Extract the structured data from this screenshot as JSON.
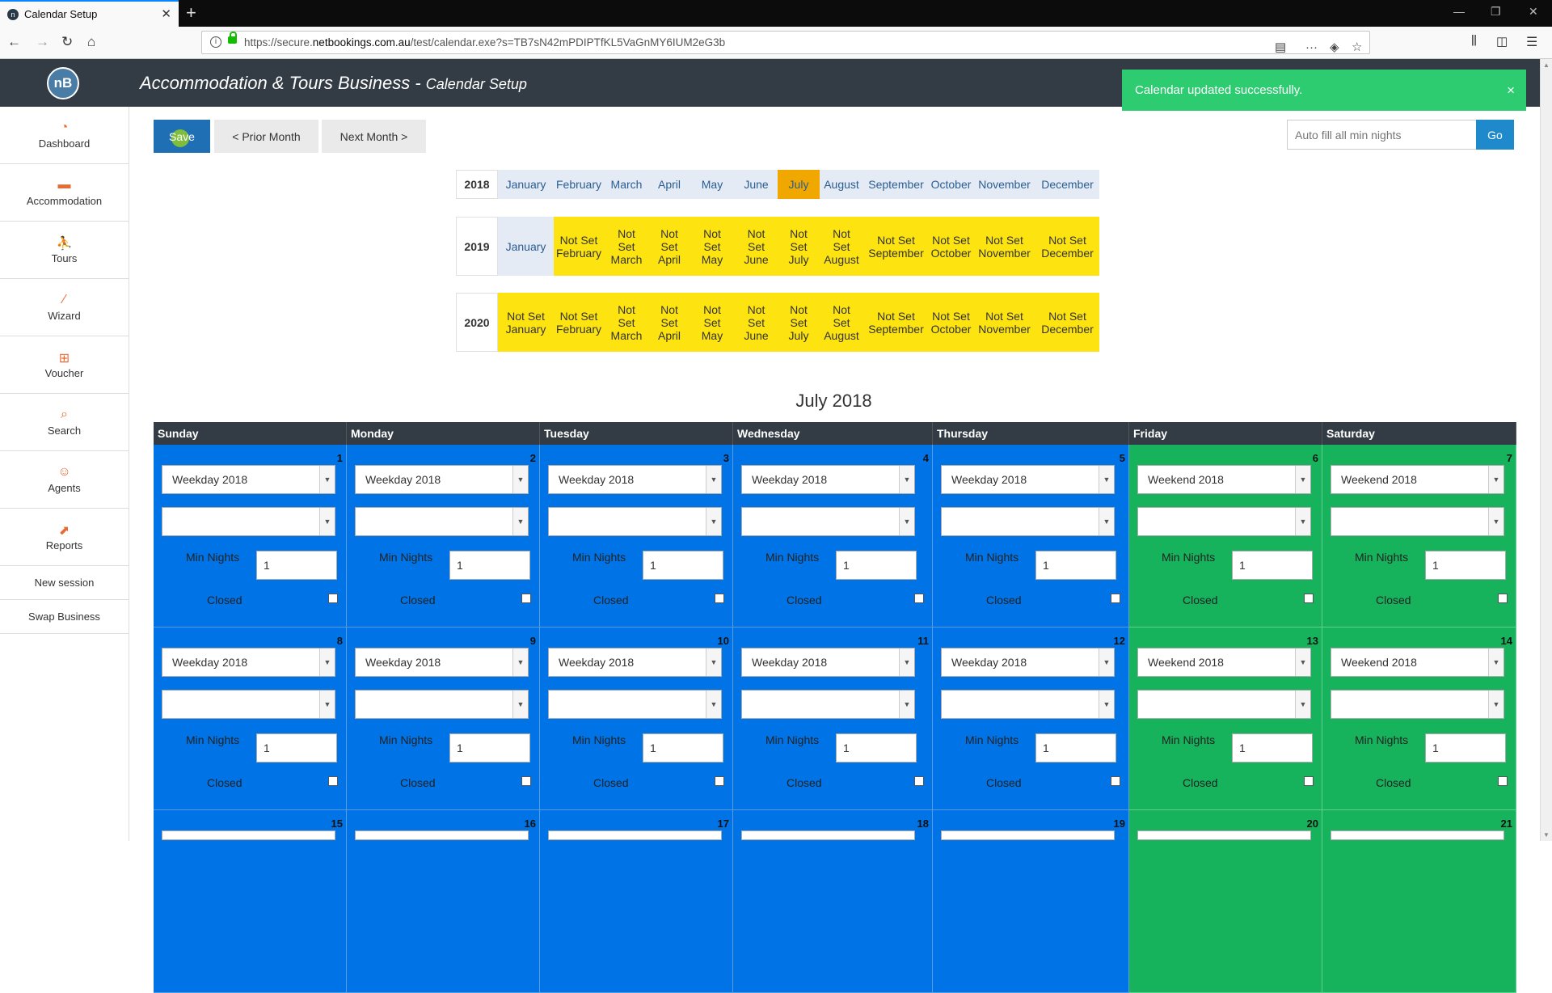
{
  "browser": {
    "tab_title": "Calendar Setup",
    "url_prefix": "https://secure.",
    "url_domain": "netbookings.com.au",
    "url_path": "/test/calendar.exe?s=TB7sN42mPDIPTfKL5VaGnMY6IUM2eG3b"
  },
  "app": {
    "logo_text": "nB",
    "title": "Accommodation & Tours Business - ",
    "subtitle": "Calendar Setup"
  },
  "toast": {
    "message": "Calendar updated successfully.",
    "close": "×"
  },
  "sidebar": {
    "items": [
      {
        "label": "Dashboard",
        "icon": "dashboard-icon",
        "glyph": "◔"
      },
      {
        "label": "Accommodation",
        "icon": "bed-icon",
        "glyph": "▬"
      },
      {
        "label": "Tours",
        "icon": "hiker-icon",
        "glyph": "⛹"
      },
      {
        "label": "Wizard",
        "icon": "wand-icon",
        "glyph": "⁄"
      },
      {
        "label": "Voucher",
        "icon": "gift-icon",
        "glyph": "⊞"
      },
      {
        "label": "Search",
        "icon": "search-icon",
        "glyph": "⌕"
      },
      {
        "label": "Agents",
        "icon": "agent-icon",
        "glyph": "☺"
      },
      {
        "label": "Reports",
        "icon": "chart-icon",
        "glyph": "⬈"
      }
    ],
    "links": [
      "New session",
      "Swap Business"
    ]
  },
  "toolbar": {
    "save": "Save",
    "prior": "< Prior Month",
    "next": "Next Month >",
    "autofill_placeholder": "Auto fill all min nights",
    "go": "Go"
  },
  "years": [
    {
      "year": "2018",
      "months": [
        {
          "l1": "January",
          "state": "set"
        },
        {
          "l1": "February",
          "state": "set"
        },
        {
          "l1": "March",
          "state": "set"
        },
        {
          "l1": "April",
          "state": "set"
        },
        {
          "l1": "May",
          "state": "set"
        },
        {
          "l1": "June",
          "state": "set"
        },
        {
          "l1": "July",
          "state": "sel"
        },
        {
          "l1": "August",
          "state": "set"
        },
        {
          "l1": "September",
          "state": "set"
        },
        {
          "l1": "October",
          "state": "set"
        },
        {
          "l1": "November",
          "state": "set"
        },
        {
          "l1": "December",
          "state": "set"
        }
      ]
    },
    {
      "year": "2019",
      "months": [
        {
          "l1": "January",
          "state": "set"
        },
        {
          "l1": "Not Set",
          "l2": "February",
          "state": "ns"
        },
        {
          "l1": "Not",
          "l2": "Set",
          "l3": "March",
          "state": "ns"
        },
        {
          "l1": "Not",
          "l2": "Set",
          "l3": "April",
          "state": "ns"
        },
        {
          "l1": "Not",
          "l2": "Set",
          "l3": "May",
          "state": "ns"
        },
        {
          "l1": "Not",
          "l2": "Set",
          "l3": "June",
          "state": "ns"
        },
        {
          "l1": "Not",
          "l2": "Set",
          "l3": "July",
          "state": "ns"
        },
        {
          "l1": "Not",
          "l2": "Set",
          "l3": "August",
          "state": "ns"
        },
        {
          "l1": "Not Set",
          "l2": "September",
          "state": "ns"
        },
        {
          "l1": "Not Set",
          "l2": "October",
          "state": "ns"
        },
        {
          "l1": "Not Set",
          "l2": "November",
          "state": "ns"
        },
        {
          "l1": "Not Set",
          "l2": "December",
          "state": "ns"
        }
      ]
    },
    {
      "year": "2020",
      "months": [
        {
          "l1": "Not Set",
          "l2": "January",
          "state": "ns"
        },
        {
          "l1": "Not Set",
          "l2": "February",
          "state": "ns"
        },
        {
          "l1": "Not",
          "l2": "Set",
          "l3": "March",
          "state": "ns"
        },
        {
          "l1": "Not",
          "l2": "Set",
          "l3": "April",
          "state": "ns"
        },
        {
          "l1": "Not",
          "l2": "Set",
          "l3": "May",
          "state": "ns"
        },
        {
          "l1": "Not",
          "l2": "Set",
          "l3": "June",
          "state": "ns"
        },
        {
          "l1": "Not",
          "l2": "Set",
          "l3": "July",
          "state": "ns"
        },
        {
          "l1": "Not",
          "l2": "Set",
          "l3": "August",
          "state": "ns"
        },
        {
          "l1": "Not Set",
          "l2": "September",
          "state": "ns"
        },
        {
          "l1": "Not Set",
          "l2": "October",
          "state": "ns"
        },
        {
          "l1": "Not Set",
          "l2": "November",
          "state": "ns"
        },
        {
          "l1": "Not Set",
          "l2": "December",
          "state": "ns"
        }
      ]
    }
  ],
  "calendar": {
    "month_title": "July 2018",
    "day_names": [
      "Sunday",
      "Monday",
      "Tuesday",
      "Wednesday",
      "Thursday",
      "Friday",
      "Saturday"
    ],
    "min_nights_label": "Min Nights",
    "closed_label": "Closed",
    "weeks": [
      [
        {
          "day": "1",
          "rate": "Weekday 2018",
          "kind": "wd",
          "min": "1"
        },
        {
          "day": "2",
          "rate": "Weekday 2018",
          "kind": "wd",
          "min": "1"
        },
        {
          "day": "3",
          "rate": "Weekday 2018",
          "kind": "wd",
          "min": "1"
        },
        {
          "day": "4",
          "rate": "Weekday 2018",
          "kind": "wd",
          "min": "1"
        },
        {
          "day": "5",
          "rate": "Weekday 2018",
          "kind": "wd",
          "min": "1"
        },
        {
          "day": "6",
          "rate": "Weekend 2018",
          "kind": "we",
          "min": "1"
        },
        {
          "day": "7",
          "rate": "Weekend 2018",
          "kind": "we",
          "min": "1"
        }
      ],
      [
        {
          "day": "8",
          "rate": "Weekday 2018",
          "kind": "wd",
          "min": "1"
        },
        {
          "day": "9",
          "rate": "Weekday 2018",
          "kind": "wd",
          "min": "1"
        },
        {
          "day": "10",
          "rate": "Weekday 2018",
          "kind": "wd",
          "min": "1"
        },
        {
          "day": "11",
          "rate": "Weekday 2018",
          "kind": "wd",
          "min": "1"
        },
        {
          "day": "12",
          "rate": "Weekday 2018",
          "kind": "wd",
          "min": "1"
        },
        {
          "day": "13",
          "rate": "Weekend 2018",
          "kind": "we",
          "min": "1"
        },
        {
          "day": "14",
          "rate": "Weekend 2018",
          "kind": "we",
          "min": "1"
        }
      ],
      [
        {
          "day": "15",
          "kind": "wd"
        },
        {
          "day": "16",
          "kind": "wd"
        },
        {
          "day": "17",
          "kind": "wd"
        },
        {
          "day": "18",
          "kind": "wd"
        },
        {
          "day": "19",
          "kind": "wd"
        },
        {
          "day": "20",
          "kind": "we"
        },
        {
          "day": "21",
          "kind": "we"
        }
      ]
    ]
  },
  "colors": {
    "weekday": "#0073e6",
    "weekend": "#16b35c",
    "selected_month": "#f0a800",
    "not_set": "#fde30f",
    "toast": "#2ecc71",
    "header": "#333b44"
  }
}
